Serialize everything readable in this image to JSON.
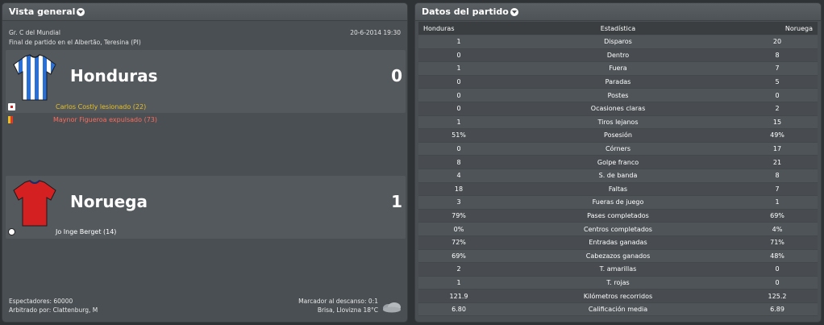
{
  "overview": {
    "title": "Vista general",
    "competition": "Gr. C del Mundial",
    "datetime": "20-6-2014 19:30",
    "venue": "Final de partido en el Albertão, Teresina (PI)",
    "home": {
      "name": "Honduras",
      "score": "0",
      "shirt_colors": {
        "primary": "#2a6fd6",
        "secondary": "#ffffff"
      },
      "events": [
        {
          "icon": "injury-icon",
          "text": "Carlos Costly lesionado (22)",
          "color": "#e8c020"
        },
        {
          "icon": "red-card-icon",
          "text": "Maynor Figueroa expulsado (73)",
          "color": "#ff6b5b"
        }
      ]
    },
    "away": {
      "name": "Noruega",
      "score": "1",
      "shirt_colors": {
        "primary": "#d42020",
        "secondary": "#1a2a6a"
      },
      "events": [
        {
          "icon": "goal-ball-icon",
          "text": "Jo Inge Berget (14)",
          "color": "#ffffff"
        }
      ]
    },
    "spectators": "Espectadores: 60000",
    "referee": "Arbitrado por: Clattenburg, M",
    "halftime": "Marcador al descanso: 0:1",
    "weather": "Brisa, Llovizna 18°C"
  },
  "stats": {
    "title": "Datos del partido",
    "header": {
      "home": "Honduras",
      "label": "Estadística",
      "away": "Noruega"
    },
    "rows": [
      {
        "home": "1",
        "label": "Disparos",
        "away": "20"
      },
      {
        "home": "0",
        "label": "Dentro",
        "away": "8"
      },
      {
        "home": "1",
        "label": "Fuera",
        "away": "7"
      },
      {
        "home": "0",
        "label": "Paradas",
        "away": "5"
      },
      {
        "home": "0",
        "label": "Postes",
        "away": "0"
      },
      {
        "home": "0",
        "label": "Ocasiones claras",
        "away": "2"
      },
      {
        "home": "1",
        "label": "Tiros lejanos",
        "away": "15"
      },
      {
        "home": "51%",
        "label": "Posesión",
        "away": "49%"
      },
      {
        "home": "0",
        "label": "Córners",
        "away": "17"
      },
      {
        "home": "8",
        "label": "Golpe franco",
        "away": "21"
      },
      {
        "home": "4",
        "label": "S. de banda",
        "away": "8"
      },
      {
        "home": "18",
        "label": "Faltas",
        "away": "7"
      },
      {
        "home": "3",
        "label": "Fueras de juego",
        "away": "1"
      },
      {
        "home": "79%",
        "label": "Pases completados",
        "away": "69%"
      },
      {
        "home": "0%",
        "label": "Centros completados",
        "away": "4%"
      },
      {
        "home": "72%",
        "label": "Entradas ganadas",
        "away": "71%"
      },
      {
        "home": "69%",
        "label": "Cabezazos ganados",
        "away": "48%"
      },
      {
        "home": "2",
        "label": "T. amarillas",
        "away": "0"
      },
      {
        "home": "1",
        "label": "T. rojas",
        "away": "0"
      },
      {
        "home": "121.9",
        "label": "Kilómetros recorridos",
        "away": "125.2"
      },
      {
        "home": "6.80",
        "label": "Calificación media",
        "away": "6.89"
      }
    ]
  }
}
